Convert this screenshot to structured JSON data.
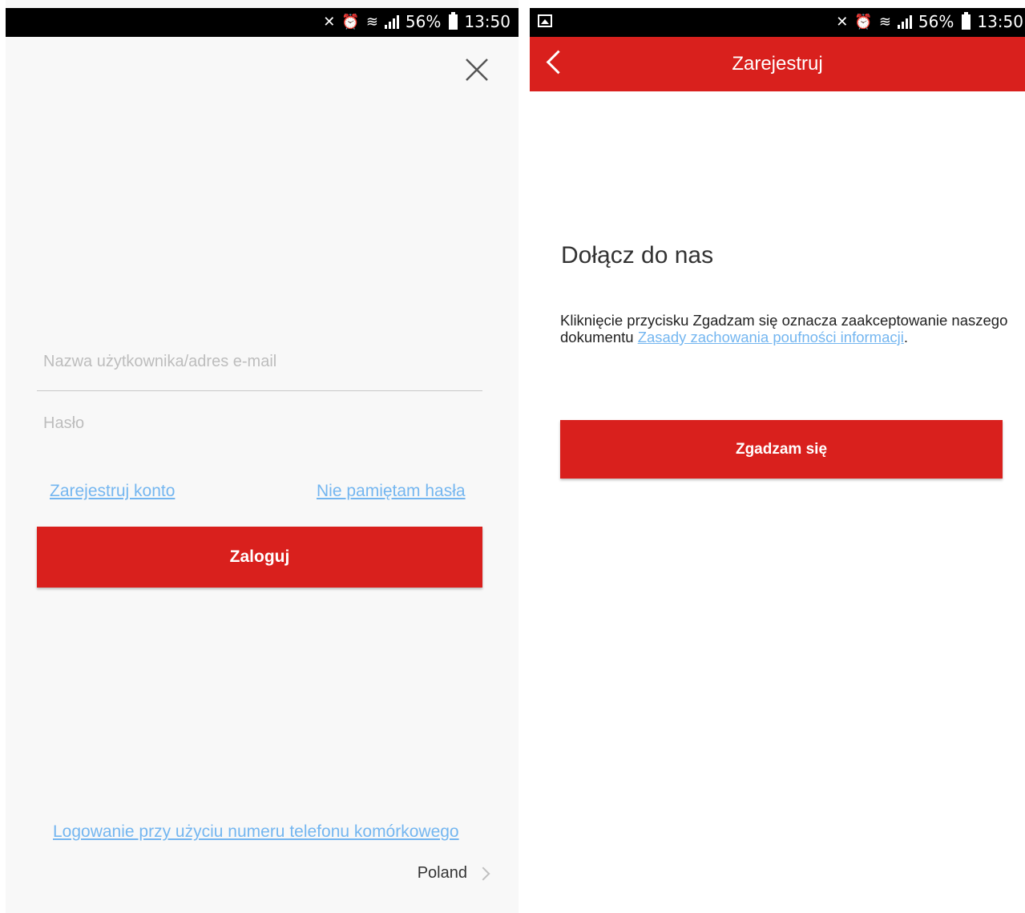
{
  "status": {
    "battery": "56%",
    "time": "13:50"
  },
  "login": {
    "username_placeholder": "Nazwa użytkownika/adres e-mail",
    "password_placeholder": "Hasło",
    "register_link": "Zarejestruj konto",
    "forgot_link": "Nie pamiętam hasła",
    "login_button": "Zaloguj",
    "phone_login_link": "Logowanie przy użyciu numeru telefonu komórkowego",
    "region": "Poland"
  },
  "register": {
    "title": "Zarejestruj",
    "heading": "Dołącz do nas",
    "notice_text": "Kliknięcie przycisku Zgadzam się oznacza zaakceptowanie naszego dokumentu",
    "policy_link": "Zasady zachowania poufności informacji",
    "agree_button": "Zgadzam się"
  },
  "colors": {
    "accent_red": "#d9201d",
    "link_blue": "#74b6f0"
  }
}
